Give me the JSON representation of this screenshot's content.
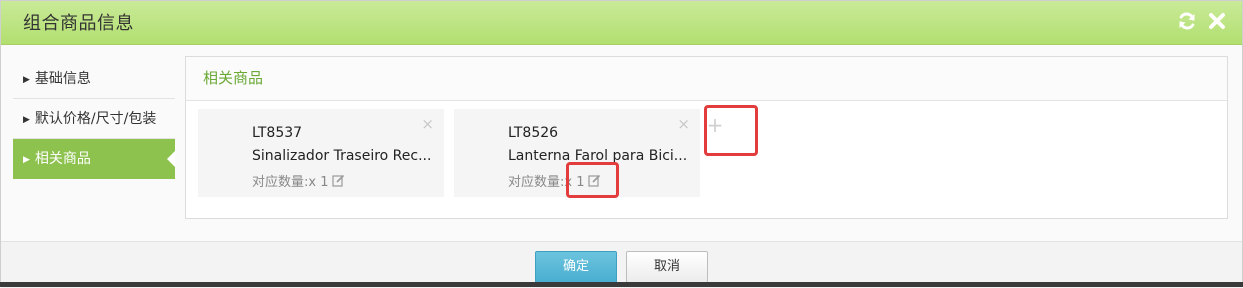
{
  "dialog": {
    "title": "组合商品信息",
    "icons": [
      "refresh-icon",
      "close-icon"
    ]
  },
  "sidebar": {
    "items": [
      {
        "label": "基础信息",
        "active": false
      },
      {
        "label": "默认价格/尺寸/包装",
        "active": false
      },
      {
        "label": "相关商品",
        "active": true
      }
    ]
  },
  "panel": {
    "heading": "相关商品",
    "products": [
      {
        "code": "LT8537",
        "name": "Sinalizador Traseiro Rec...",
        "qty": "对应数量:x 1"
      },
      {
        "code": "LT8526",
        "name": "Lanterna Farol para Bici...",
        "qty": "对应数量:x 1"
      }
    ],
    "add_label": "+",
    "remove_label": "×"
  },
  "footer": {
    "confirm_label": "确定",
    "cancel_label": "取消"
  },
  "colors": {
    "titlebar": "#b2df70",
    "accent": "#8dc24f",
    "heading": "#6aa936",
    "confirm": "#4aaed0",
    "highlight": "#e23c3c"
  }
}
